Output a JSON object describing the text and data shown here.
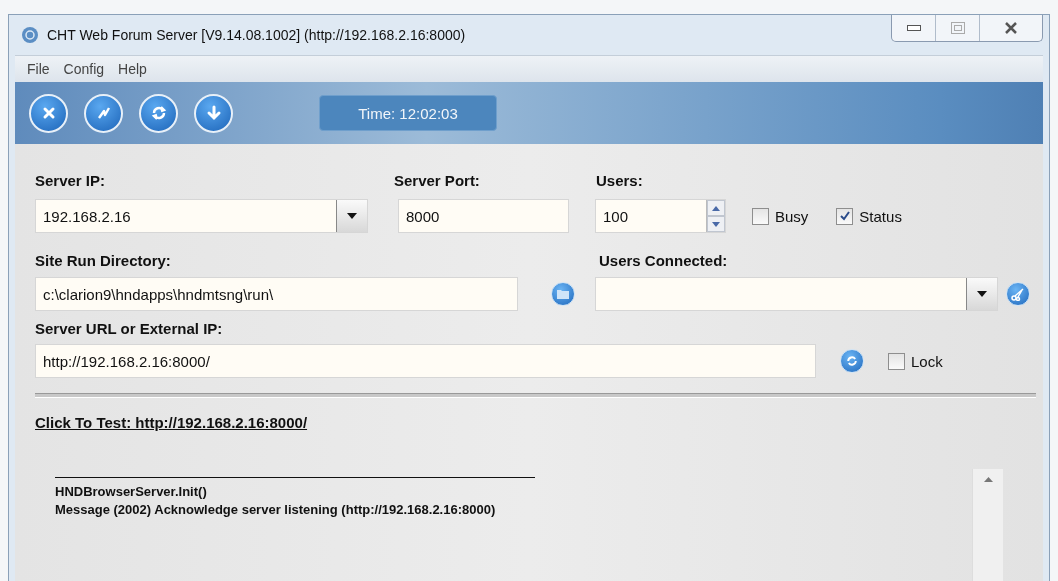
{
  "window": {
    "title": "CHT Web Forum Server [V9.14.08.1002] (http://192.168.2.16:8000)"
  },
  "menu": [
    "File",
    "Config",
    "Help"
  ],
  "toolbar": {
    "time": "Time: 12:02:03"
  },
  "form": {
    "server_ip": {
      "label": "Server IP:",
      "value": "192.168.2.16"
    },
    "server_port": {
      "label": "Server Port:",
      "value": "8000"
    },
    "users": {
      "label": "Users:",
      "value": "100"
    },
    "checkboxes": [
      {
        "label": "Busy",
        "checked": false
      },
      {
        "label": "Status",
        "checked": true
      }
    ],
    "site_run_directory": {
      "label": "Site Run Directory:",
      "value": "c:\\clarion9\\hndapps\\hndmtsng\\run\\"
    },
    "users_connected": {
      "label": "Users Connected:"
    },
    "server_url": {
      "label": "Server URL or External IP:",
      "value": "http://192.168.2.16:8000/"
    },
    "lock": {
      "label": "Lock",
      "checked": false
    }
  },
  "test_link": "Click To Test: http://192.168.2.16:8000/",
  "log": [
    "HNDBrowserServer.Init()",
    "Message (2002) Acknowledge server listening (http://192.168.2.16:8000)"
  ]
}
